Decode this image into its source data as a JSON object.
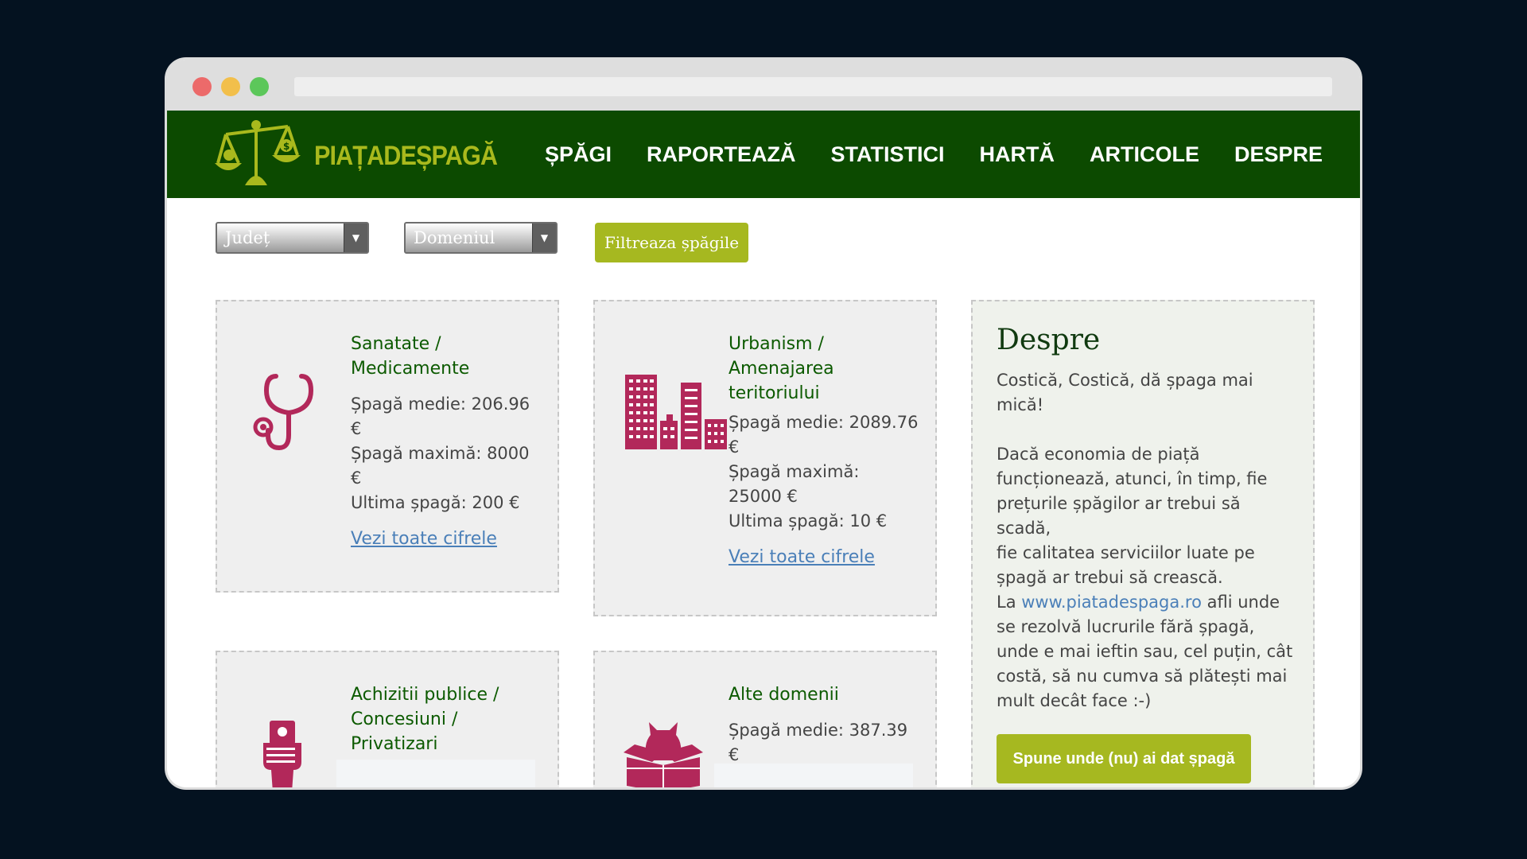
{
  "site": {
    "logo_text": "PIAȚADEȘPAGĂ",
    "nav": [
      "ȘPĂGI",
      "RAPORTEAZĂ",
      "STATISTICI",
      "HARTĂ",
      "ARTICOLE",
      "DESPRE"
    ]
  },
  "filters": {
    "county_placeholder": "Județ",
    "domain_placeholder": "Domeniul",
    "button_label": "Filtreaza șpăgile"
  },
  "categories": [
    {
      "title_lines": [
        "Sanatate /",
        "Medicamente"
      ],
      "stats": [
        "Șpagă medie: 206.96",
        "€",
        "Șpagă maximă: 8000",
        "€",
        "Ultima șpagă: 200 €"
      ],
      "link": "Vezi toate cifrele",
      "icon": "stethoscope-icon"
    },
    {
      "title_lines": [
        "Urbanism /",
        "Amenajarea",
        "teritoriului"
      ],
      "stats": [
        "Șpagă medie: 2089.76",
        "€",
        "Șpagă maximă:",
        "25000 €",
        "Ultima șpagă: 10 €"
      ],
      "link": "Vezi toate cifrele",
      "icon": "buildings-icon"
    },
    {
      "title_lines": [
        "Achizitii publice /",
        "Concesiuni /",
        "Privatizari"
      ],
      "stats": [],
      "link": "",
      "icon": "money-hand-icon"
    },
    {
      "title_lines": [
        "Alte domenii"
      ],
      "stats": [
        "Șpagă medie: 387.39",
        "€"
      ],
      "link": "",
      "icon": "cat-box-icon"
    }
  ],
  "about": {
    "heading": "Despre",
    "tagline": [
      "Costică, Costică, dă șpaga mai",
      "mică!"
    ],
    "paragraph": [
      "Dacă economia de piață",
      "funcționează, atunci, în timp, fie",
      "prețurile șpăgilor ar trebui să scadă,",
      "fie calitatea serviciilor luate pe",
      "șpagă ar trebui să crească."
    ],
    "link_prefix": "La ",
    "link_text": "www.piatadespaga.ro",
    "link_suffix": " afli unde",
    "closing": [
      "se rezolvă lucrurile fără șpagă,",
      "unde e mai ieftin sau, cel puțin, cât",
      "costă, să nu cumva să plătești mai",
      "mult decât face :-)"
    ],
    "button_label": "Spune unde (nu) ai dat șpagă"
  },
  "colors": {
    "nav_bg": "#0c4a00",
    "accent": "#a6b820",
    "icon": "#b2285a",
    "title_green": "#0c5a00",
    "link_blue": "#4a7fb8"
  }
}
